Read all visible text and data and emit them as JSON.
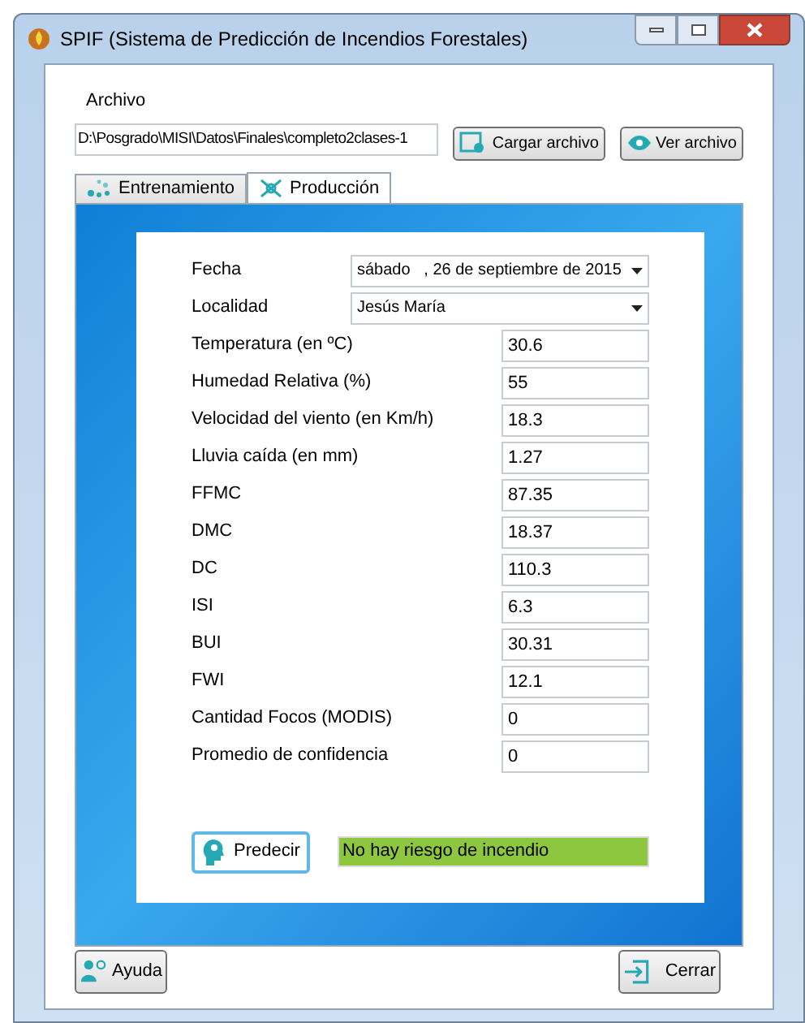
{
  "window": {
    "title": "SPIF (Sistema de Predicción de Incendios Forestales)"
  },
  "file": {
    "label": "Archivo",
    "value": "D:\\Posgrado\\MISI\\Datos\\Finales\\completo2clases-1",
    "buttons": [
      "Cargar archivo",
      "Ver archivo"
    ]
  },
  "tabs": [
    {
      "label": "Entrenamiento",
      "selected": false
    },
    {
      "label": "Producción",
      "selected": true
    }
  ],
  "fields": [
    {
      "kind": "dropdown",
      "label": "Fecha",
      "value": "sábado   , 26 de septiembre de 2015"
    },
    {
      "kind": "dropdown",
      "label": "Localidad",
      "value": "Jesús María"
    },
    {
      "kind": "input",
      "label": "Temperatura (en ºC)",
      "value": "30.6"
    },
    {
      "kind": "input",
      "label": "Humedad Relativa (%)",
      "value": "55"
    },
    {
      "kind": "input",
      "label": "Velocidad del viento (en Km/h)",
      "value": "18.3"
    },
    {
      "kind": "input",
      "label": "Lluvia caída (en mm)",
      "value": "1.27"
    },
    {
      "kind": "input",
      "label": "FFMC",
      "value": "87.35"
    },
    {
      "kind": "input",
      "label": "DMC",
      "value": "18.37"
    },
    {
      "kind": "input",
      "label": "DC",
      "value": "110.3"
    },
    {
      "kind": "input",
      "label": "ISI",
      "value": "6.3"
    },
    {
      "kind": "input",
      "label": "BUI",
      "value": "30.31"
    },
    {
      "kind": "input",
      "label": "FWI",
      "value": "12.1"
    },
    {
      "kind": "input",
      "label": "Cantidad Focos (MODIS)",
      "value": "0"
    },
    {
      "kind": "input",
      "label": "Promedio de confidencia",
      "value": "0"
    }
  ],
  "predict": {
    "button": "Predecir",
    "result": "No hay riesgo de incendio"
  },
  "footer": {
    "help": "Ayuda",
    "close": "Cerrar"
  }
}
